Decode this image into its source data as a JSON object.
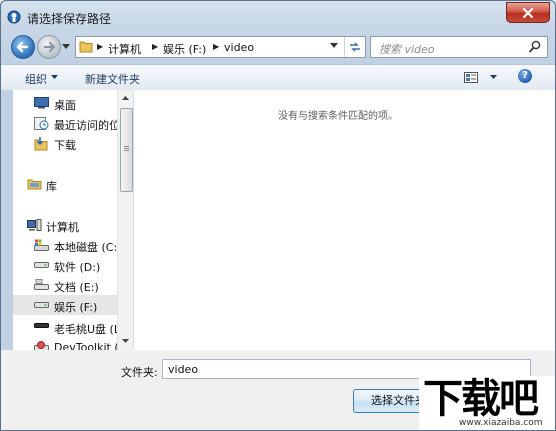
{
  "window": {
    "title": "请选择保存路径"
  },
  "address": {
    "crumbs": [
      "计算机",
      "娱乐 (F:)",
      "video"
    ]
  },
  "search": {
    "placeholder": "搜索 video"
  },
  "toolbar": {
    "organize_label": "组织",
    "new_folder_label": "新建文件夹",
    "help_symbol": "?"
  },
  "sidebar": {
    "items": [
      {
        "label": "桌面",
        "icon": "desktop-icon"
      },
      {
        "label": "最近访问的位",
        "icon": "recent-places-icon"
      },
      {
        "label": "下载",
        "icon": "downloads-folder-icon"
      },
      {
        "label": "库",
        "icon": "library-icon"
      },
      {
        "label": "计算机",
        "icon": "computer-icon"
      },
      {
        "label": "本地磁盘 (C:)",
        "icon": "system-drive-icon"
      },
      {
        "label": "软件 (D:)",
        "icon": "drive-icon"
      },
      {
        "label": "文档 (E:)",
        "icon": "drive-icon"
      },
      {
        "label": "娱乐 (F:)",
        "icon": "drive-icon",
        "selected": true
      },
      {
        "label": "老毛桃U盘 (L",
        "icon": "usb-drive-icon"
      },
      {
        "label": "DevToolkit (",
        "icon": "disc-drive-icon"
      }
    ]
  },
  "content": {
    "empty_message": "没有与搜索条件匹配的项。"
  },
  "footer": {
    "folder_label": "文件夹:",
    "folder_value": "video",
    "select_button": "选择文件夹"
  },
  "watermark": {
    "logo": "下载吧",
    "url": "www.xiazaiba.com"
  },
  "colors": {
    "accent": "#1e395b",
    "close": "#c84a38",
    "selection": "#e6e6e6"
  }
}
